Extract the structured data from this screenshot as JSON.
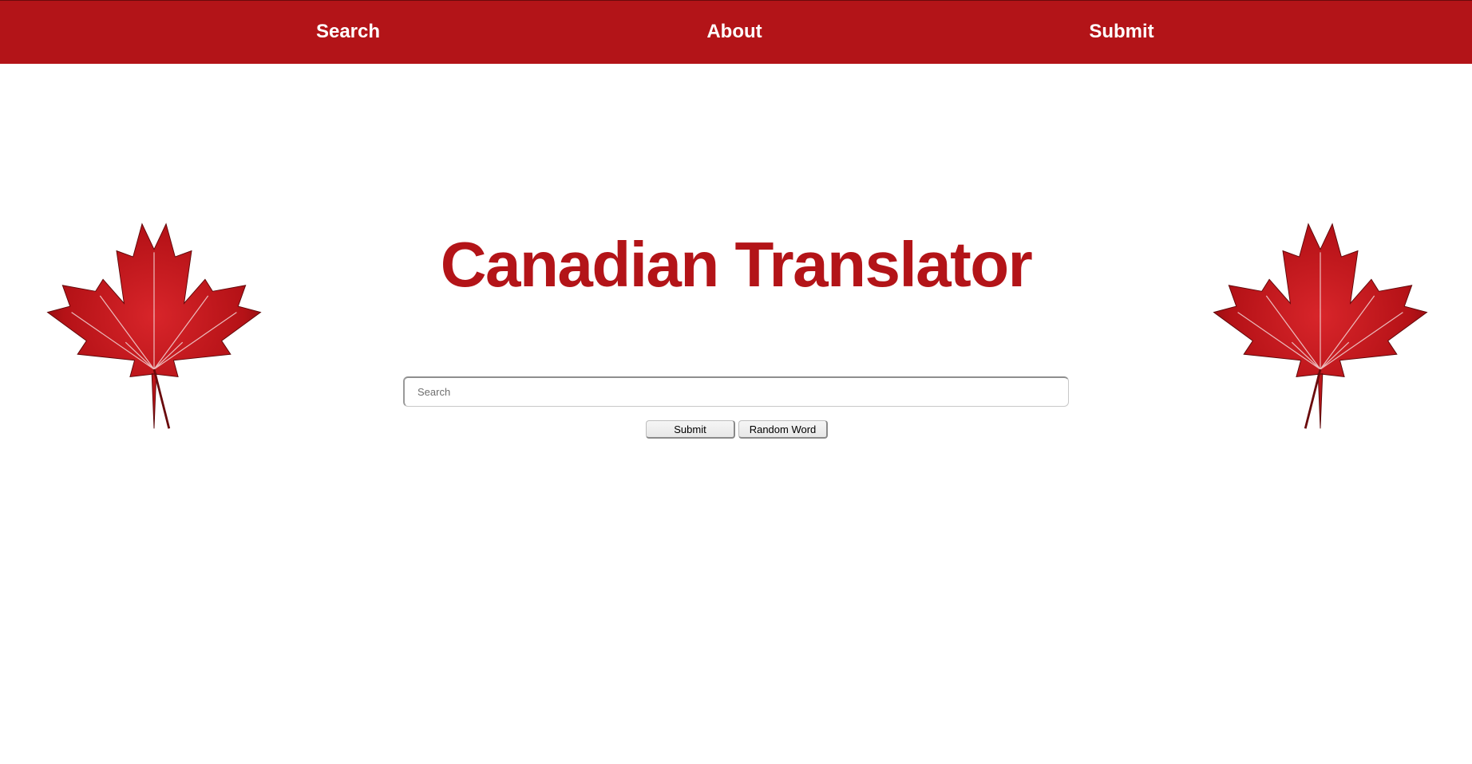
{
  "nav": {
    "items": [
      {
        "label": "Search"
      },
      {
        "label": "About"
      },
      {
        "label": "Submit"
      }
    ]
  },
  "main": {
    "title": "Canadian Translator",
    "search": {
      "placeholder": "Search",
      "value": ""
    },
    "submit_label": "Submit",
    "random_label": "Random Word"
  },
  "colors": {
    "brand_red": "#b31418",
    "leaf_red": "#c0161b",
    "leaf_vein": "#f3d7d7",
    "background": "#ffffff"
  },
  "images": {
    "left": "maple-leaf-icon",
    "right": "maple-leaf-icon"
  }
}
